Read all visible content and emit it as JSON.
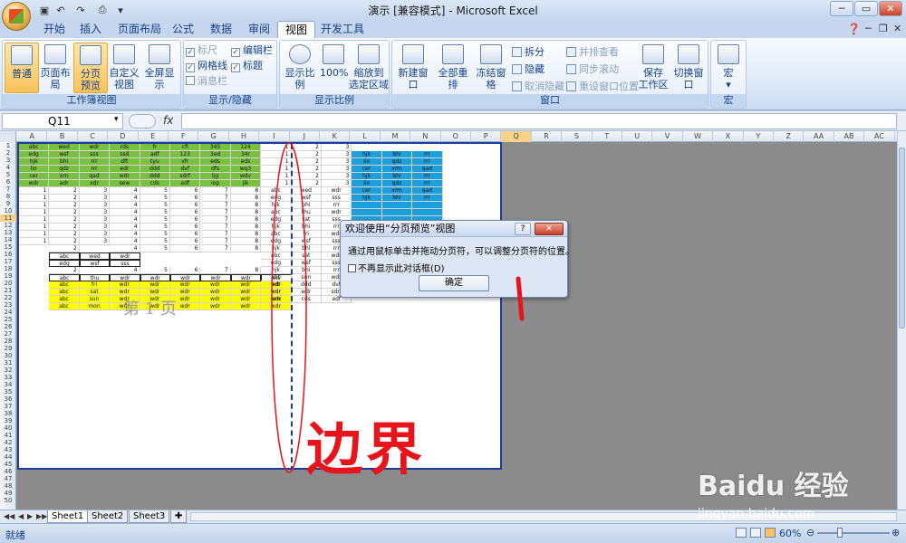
{
  "window": {
    "title": "演示 [兼容模式] - Microsoft Excel"
  },
  "tabs": [
    "开始",
    "插入",
    "页面布局",
    "公式",
    "数据",
    "审阅",
    "视图",
    "开发工具"
  ],
  "ribbon": {
    "workbook_views": {
      "label": "工作簿视图",
      "normal": "普通",
      "page_layout": "页面布局",
      "page_break": "分页\n预览",
      "custom": "自定义\n视图",
      "full_screen": "全屏显示"
    },
    "show_hide": {
      "label": "显示/隐藏",
      "ruler": "标尺",
      "gridlines": "网格线",
      "message_bar": "消息栏",
      "formula_bar": "编辑栏",
      "headings": "标题"
    },
    "zoom": {
      "label": "显示比例",
      "zoom": "显示比例",
      "hundred": "100%",
      "zoom_sel": "缩放到\n选定区域"
    },
    "window": {
      "label": "窗口",
      "new_window": "新建窗口",
      "arrange_all": "全部重排",
      "freeze": "冻结窗格",
      "split": "拆分",
      "hide": "隐藏",
      "unhide": "取消隐藏",
      "side_by_side": "并排查看",
      "sync_scroll": "同步滚动",
      "reset_pos": "重设窗口位置",
      "save_ws": "保存\n工作区",
      "switch": "切换窗口"
    },
    "macros": {
      "label": "宏",
      "macros": "宏"
    }
  },
  "formula": {
    "namebox": "Q11",
    "fx": "fx",
    "value": ""
  },
  "columns": [
    "A",
    "B",
    "C",
    "D",
    "E",
    "F",
    "G",
    "H",
    "I",
    "J",
    "K",
    "L",
    "M",
    "N",
    "O",
    "P",
    "Q",
    "R",
    "S",
    "T",
    "U",
    "V",
    "W",
    "X",
    "Y",
    "Z",
    "AA",
    "AB",
    "AC"
  ],
  "selected_column": "Q",
  "selected_row": 11,
  "cells": {
    "g1": [
      [
        "abc",
        "wed",
        "wdr",
        "rds",
        "fr",
        "cfi",
        "345",
        "124"
      ],
      [
        "edg",
        "wsf",
        "sss",
        "ssd",
        "adf",
        "123",
        "3ed",
        "34r"
      ],
      [
        "hjk",
        "bhi",
        "rrr",
        "dft",
        "tyu",
        "vfr",
        "eds",
        "eds"
      ],
      [
        "lio",
        "qdz",
        "rrr",
        "edr",
        "ddd",
        "dvf",
        "dfs",
        "wq3"
      ],
      [
        "cer",
        "xrn",
        "qad",
        "wdr",
        "ddd",
        "sdrf",
        "ljg",
        "wdv"
      ],
      [
        "wdr",
        "adr",
        "xdr",
        "sew",
        "cds",
        "adf",
        "iop",
        "jik"
      ]
    ],
    "num_rows": [
      [
        1,
        2,
        3,
        4,
        5,
        6,
        7,
        8
      ],
      [
        1,
        2,
        3,
        4,
        5,
        6,
        7,
        8
      ],
      [
        1,
        2,
        3,
        4,
        5,
        6,
        7,
        8
      ],
      [
        1,
        2,
        3,
        4,
        5,
        6,
        7,
        8
      ],
      [
        1,
        2,
        3,
        4,
        5,
        6,
        7,
        8
      ],
      [
        1,
        2,
        3,
        4,
        5,
        6,
        7,
        8
      ],
      [
        1,
        2,
        3,
        4,
        5,
        6,
        7,
        8
      ],
      [
        1,
        2,
        3,
        4,
        5,
        6,
        7,
        8
      ]
    ],
    "row15": [
      "2",
      "4",
      "5",
      "6",
      "7",
      "8"
    ],
    "box": [
      [
        "abc",
        "wed",
        "wdr"
      ],
      [
        "edg",
        "wsf",
        "sss"
      ]
    ],
    "row18": [
      "2",
      "4",
      "5",
      "6",
      "7",
      "8"
    ],
    "row19": [
      "abc",
      "thu",
      "wdr",
      "wdr",
      "wdr",
      "wdr",
      "wdr",
      "wdr"
    ],
    "yellow": [
      [
        "abc",
        "fri",
        "wdr",
        "wdr",
        "wdr",
        "wdr",
        "wdr",
        "wdr"
      ],
      [
        "abc",
        "sat",
        "wdr",
        "wdr",
        "wdr",
        "wdr",
        "wdr",
        "wdr"
      ],
      [
        "abc",
        "sun",
        "wdr",
        "wdr",
        "wdr",
        "wdr",
        "wdr",
        "wdr"
      ],
      [
        "abc",
        "mon",
        "wdr",
        "wdr",
        "wdr",
        "wdr",
        "wdr",
        "wdr"
      ]
    ],
    "ijk_top": [
      [
        "1",
        "2",
        "3"
      ],
      [
        "1",
        "2",
        "3"
      ],
      [
        "1",
        "2",
        "3"
      ],
      [
        "1",
        "2",
        "3"
      ],
      [
        "1",
        "2",
        "3"
      ],
      [
        "1",
        "2",
        "3"
      ]
    ],
    "ijk": [
      [
        "abc",
        "wed",
        "wdr"
      ],
      [
        "edg",
        "wsf",
        "sss"
      ],
      [
        "hjk",
        "bhi",
        "rrr"
      ],
      [
        "abc",
        "thu",
        "wdr"
      ],
      [
        "edg",
        "sat",
        "sss"
      ],
      [
        "hjk",
        "bhi",
        "rrr"
      ],
      [
        "abc",
        "fri",
        "wdr"
      ],
      [
        "edg",
        "wsf",
        "sss"
      ],
      [
        "hjk",
        "bhi",
        "rrr"
      ],
      [
        "abc",
        "sat",
        "wdr"
      ],
      [
        "edg",
        "wsf",
        "sss"
      ],
      [
        "hjk",
        "bhi",
        "rrr"
      ],
      [
        "abc",
        "sun",
        "wdr"
      ],
      [
        "edt",
        "ddd",
        "dvf"
      ],
      [
        "wdr",
        "wdr",
        "sdrf"
      ],
      [
        "sew",
        "cds",
        "adf"
      ]
    ],
    "blue": [
      [
        "hjk",
        "bhi",
        "rrr"
      ],
      [
        "lio",
        "qdz",
        "rrr"
      ],
      [
        "cer",
        "xrm",
        "qad"
      ],
      [
        "hjk",
        "bhi",
        "rrr"
      ],
      [
        "lio",
        "qdz",
        "rrr"
      ],
      [
        "cer",
        "xrm",
        "qad"
      ],
      [
        "hjk",
        "bhi",
        "rrr"
      ],
      [
        "",
        "",
        ""
      ],
      [
        "",
        "",
        ""
      ],
      [
        "",
        "",
        ""
      ],
      [
        "",
        "",
        ""
      ],
      [
        "",
        "",
        ""
      ],
      [
        "",
        "",
        ""
      ],
      [
        "",
        "",
        ""
      ],
      [
        "",
        "",
        ""
      ],
      [
        "",
        "",
        ""
      ],
      [
        "cer",
        "xrm",
        "qad"
      ]
    ]
  },
  "page_label": "第 1 页",
  "dialog": {
    "title": "欢迎使用“分页预览”视图",
    "help": "?",
    "close": "✕",
    "message": "通过用鼠标单击并拖动分页符，可以调整分页符的位置。",
    "checkbox": "不再显示此对话框",
    "checkbox_key": "(D)",
    "ok": "确定"
  },
  "sheet_tabs": [
    "Sheet1",
    "Sheet2",
    "Sheet3"
  ],
  "status": {
    "text": "就绪",
    "zoom": "60%"
  },
  "annotation": {
    "text": "边界",
    "color": "#e8141b"
  },
  "watermark": {
    "brand": "Baidu 经验",
    "url": "jingyan.baidu.com"
  }
}
